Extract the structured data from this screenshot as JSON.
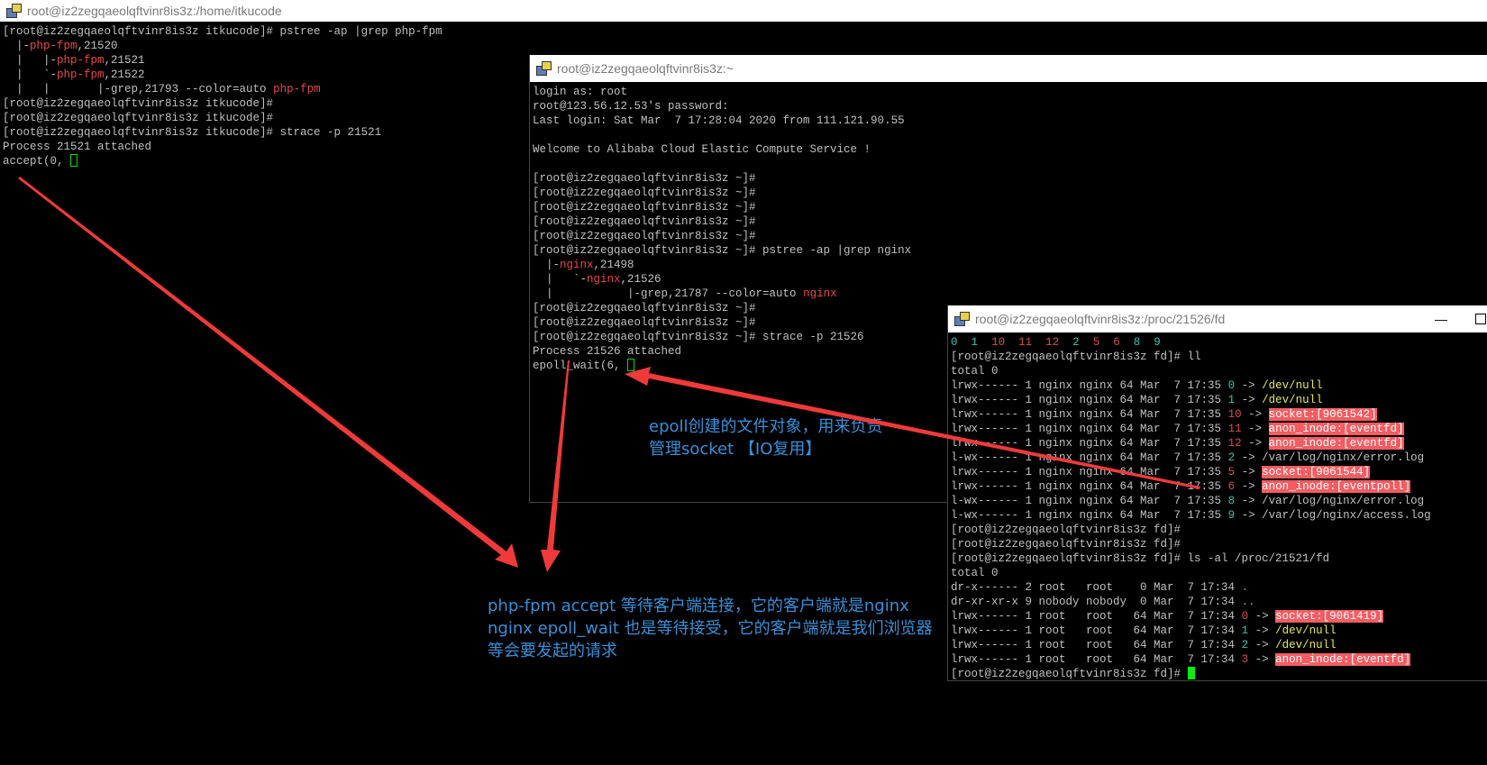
{
  "win1": {
    "title": "root@iz2zegqaeolqftvinr8is3z:/home/itkucode",
    "lines": [
      [
        [
          "[root@iz2zegqaeolqftvinr8is3z itkucode]# pstree -ap |grep php-fpm",
          ""
        ]
      ],
      [
        [
          "  |-",
          ""
        ],
        [
          "php-fpm",
          "r"
        ],
        [
          ",21520",
          ""
        ]
      ],
      [
        [
          "  |   |-",
          ""
        ],
        [
          "php-fpm",
          "r"
        ],
        [
          ",21521",
          ""
        ]
      ],
      [
        [
          "  |   `-",
          ""
        ],
        [
          "php-fpm",
          "r"
        ],
        [
          ",21522",
          ""
        ]
      ],
      [
        [
          "  |   |       |-grep,21793 --color=auto ",
          ""
        ],
        [
          "php-fpm",
          "r"
        ]
      ],
      [
        [
          "[root@iz2zegqaeolqftvinr8is3z itkucode]#",
          ""
        ]
      ],
      [
        [
          "[root@iz2zegqaeolqftvinr8is3z itkucode]#",
          ""
        ]
      ],
      [
        [
          "[root@iz2zegqaeolqftvinr8is3z itkucode]# strace -p 21521",
          ""
        ]
      ],
      [
        [
          "Process 21521 attached",
          ""
        ]
      ],
      [
        [
          "accept(0, ",
          ""
        ],
        [
          "",
          "cur-o"
        ]
      ]
    ]
  },
  "win2": {
    "title": "root@iz2zegqaeolqftvinr8is3z:~",
    "lines": [
      [
        [
          "login as: root",
          ""
        ]
      ],
      [
        [
          "root@123.56.12.53's password:",
          ""
        ]
      ],
      [
        [
          "Last login: Sat Mar  7 17:28:04 2020 from 111.121.90.55",
          ""
        ]
      ],
      [
        [
          "",
          ""
        ]
      ],
      [
        [
          "Welcome to Alibaba Cloud Elastic Compute Service !",
          ""
        ]
      ],
      [
        [
          "",
          ""
        ]
      ],
      [
        [
          "[root@iz2zegqaeolqftvinr8is3z ~]#",
          ""
        ]
      ],
      [
        [
          "[root@iz2zegqaeolqftvinr8is3z ~]#",
          ""
        ]
      ],
      [
        [
          "[root@iz2zegqaeolqftvinr8is3z ~]#",
          ""
        ]
      ],
      [
        [
          "[root@iz2zegqaeolqftvinr8is3z ~]#",
          ""
        ]
      ],
      [
        [
          "[root@iz2zegqaeolqftvinr8is3z ~]#",
          ""
        ]
      ],
      [
        [
          "[root@iz2zegqaeolqftvinr8is3z ~]# pstree -ap |grep nginx",
          ""
        ]
      ],
      [
        [
          "  |-",
          ""
        ],
        [
          "nginx",
          "r"
        ],
        [
          ",21498",
          ""
        ]
      ],
      [
        [
          "  |   `-",
          ""
        ],
        [
          "nginx",
          "r"
        ],
        [
          ",21526",
          ""
        ]
      ],
      [
        [
          "  |           |-grep,21787 --color=auto ",
          ""
        ],
        [
          "nginx",
          "r"
        ]
      ],
      [
        [
          "[root@iz2zegqaeolqftvinr8is3z ~]#",
          ""
        ]
      ],
      [
        [
          "[root@iz2zegqaeolqftvinr8is3z ~]#",
          ""
        ]
      ],
      [
        [
          "[root@iz2zegqaeolqftvinr8is3z ~]# strace -p 21526",
          ""
        ]
      ],
      [
        [
          "Process 21526 attached",
          ""
        ]
      ],
      [
        [
          "epoll_wait(6, ",
          ""
        ],
        [
          "",
          "cur-o"
        ]
      ]
    ]
  },
  "win3": {
    "title": "root@iz2zegqaeolqftvinr8is3z:/proc/21526/fd",
    "minimize": "—",
    "lines": [
      [
        [
          "0",
          "c"
        ],
        [
          "  ",
          ""
        ],
        [
          "1",
          "c"
        ],
        [
          "  ",
          ""
        ],
        [
          "10",
          "m"
        ],
        [
          "  ",
          ""
        ],
        [
          "11",
          "m"
        ],
        [
          "  ",
          ""
        ],
        [
          "12",
          "m"
        ],
        [
          "  ",
          ""
        ],
        [
          "2",
          "c"
        ],
        [
          "  ",
          ""
        ],
        [
          "5",
          "m"
        ],
        [
          "  ",
          ""
        ],
        [
          "6",
          "m"
        ],
        [
          "  ",
          ""
        ],
        [
          "8",
          "c"
        ],
        [
          "  ",
          ""
        ],
        [
          "9",
          "c"
        ]
      ],
      [
        [
          "[root@iz2zegqaeolqftvinr8is3z fd]# ll",
          ""
        ]
      ],
      [
        [
          "total 0",
          ""
        ]
      ],
      [
        [
          "lrwx------ 1 nginx nginx 64 Mar  7 17:35 ",
          ""
        ],
        [
          "0",
          "c"
        ],
        [
          " -> ",
          ""
        ],
        [
          "/dev/null",
          "y"
        ]
      ],
      [
        [
          "lrwx------ 1 nginx nginx 64 Mar  7 17:35 ",
          ""
        ],
        [
          "1",
          "c"
        ],
        [
          " -> ",
          ""
        ],
        [
          "/dev/null",
          "y"
        ]
      ],
      [
        [
          "lrwx------ 1 nginx nginx 64 Mar  7 17:35 ",
          ""
        ],
        [
          "10",
          "m"
        ],
        [
          " -> ",
          ""
        ],
        [
          "socket:[9061542]",
          "h"
        ]
      ],
      [
        [
          "lrwx------ 1 nginx nginx 64 Mar  7 17:35 ",
          ""
        ],
        [
          "11",
          "m"
        ],
        [
          " -> ",
          ""
        ],
        [
          "anon_inode:[eventfd]",
          "h"
        ]
      ],
      [
        [
          "lrwx------ 1 nginx nginx 64 Mar  7 17:35 ",
          ""
        ],
        [
          "12",
          "m"
        ],
        [
          " -> ",
          ""
        ],
        [
          "anon_inode:[eventfd]",
          "h"
        ]
      ],
      [
        [
          "l-wx------ 1 nginx nginx 64 Mar  7 17:35 ",
          ""
        ],
        [
          "2",
          "c"
        ],
        [
          " -> /var/log/nginx/error.log",
          ""
        ]
      ],
      [
        [
          "lrwx------ 1 nginx nginx 64 Mar  7 17:35 ",
          ""
        ],
        [
          "5",
          "m"
        ],
        [
          " -> ",
          ""
        ],
        [
          "socket:[9061544]",
          "h"
        ]
      ],
      [
        [
          "lrwx------ 1 nginx nginx 64 Mar  7 17:35 ",
          ""
        ],
        [
          "6",
          "m"
        ],
        [
          " -> ",
          ""
        ],
        [
          "anon_inode:[eventpoll]",
          "h"
        ]
      ],
      [
        [
          "l-wx------ 1 nginx nginx 64 Mar  7 17:35 ",
          ""
        ],
        [
          "8",
          "c"
        ],
        [
          " -> /var/log/nginx/error.log",
          ""
        ]
      ],
      [
        [
          "l-wx------ 1 nginx nginx 64 Mar  7 17:35 ",
          ""
        ],
        [
          "9",
          "c"
        ],
        [
          " -> /var/log/nginx/access.log",
          ""
        ]
      ],
      [
        [
          "[root@iz2zegqaeolqftvinr8is3z fd]#",
          ""
        ]
      ],
      [
        [
          "[root@iz2zegqaeolqftvinr8is3z fd]#",
          ""
        ]
      ],
      [
        [
          "[root@iz2zegqaeolqftvinr8is3z fd]# ls -al /proc/21521/fd",
          ""
        ]
      ],
      [
        [
          "total 0",
          ""
        ]
      ],
      [
        [
          "dr-x------ 2 root   root    0 Mar  7 17:34 ",
          ""
        ],
        [
          ".",
          "c"
        ]
      ],
      [
        [
          "dr-xr-xr-x 9 nobody nobody  0 Mar  7 17:34 ",
          ""
        ],
        [
          "..",
          "c"
        ]
      ],
      [
        [
          "lrwx------ 1 root   root   64 Mar  7 17:34 ",
          ""
        ],
        [
          "0",
          "m"
        ],
        [
          " -> ",
          ""
        ],
        [
          "socket:[9061419]",
          "h"
        ]
      ],
      [
        [
          "lrwx------ 1 root   root   64 Mar  7 17:34 ",
          ""
        ],
        [
          "1",
          "c"
        ],
        [
          " -> ",
          ""
        ],
        [
          "/dev/null",
          "y"
        ]
      ],
      [
        [
          "lrwx------ 1 root   root   64 Mar  7 17:34 ",
          ""
        ],
        [
          "2",
          "c"
        ],
        [
          " -> ",
          ""
        ],
        [
          "/dev/null",
          "y"
        ]
      ],
      [
        [
          "lrwx------ 1 root   root   64 Mar  7 17:34 ",
          ""
        ],
        [
          "3",
          "m"
        ],
        [
          " -> ",
          ""
        ],
        [
          "anon_inode:[eventfd]",
          "h"
        ]
      ],
      [
        [
          "[root@iz2zegqaeolqftvinr8is3z fd]# ",
          ""
        ],
        [
          "",
          "cur-f"
        ]
      ]
    ]
  },
  "annotations": {
    "epoll_note": "epoll创建的文件对象，用来负责\n管理socket 【IO复用】",
    "main_note": "php-fpm accept 等待客户端连接，它的客户端就是nginx\nnginx epoll_wait 也是等待接受，它的客户端就是我们浏览器\n等会要发起的请求"
  },
  "colors": {
    "annotation": "#3a8fd8",
    "arrow": "#f03a3a",
    "highlight": "#f35d62",
    "cursor": "#00f000"
  }
}
